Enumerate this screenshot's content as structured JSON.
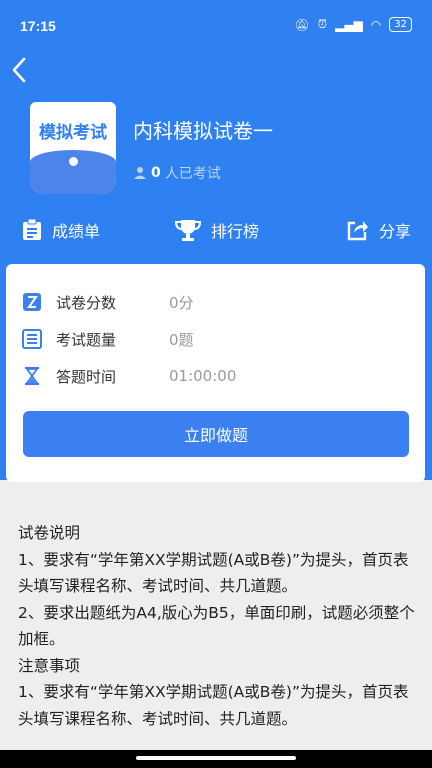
{
  "status_bar": {
    "time": "17:15",
    "battery": "32"
  },
  "header": {
    "cover_label": "模拟考试",
    "title": "内科模拟试卷一",
    "takers_count": "0",
    "takers_suffix": "人已考试"
  },
  "actions": [
    {
      "label": "成绩单",
      "icon": "clipboard-icon"
    },
    {
      "label": "排行榜",
      "icon": "trophy-icon"
    },
    {
      "label": "分享",
      "icon": "share-icon"
    }
  ],
  "info": {
    "rows": [
      {
        "label": "试卷分数",
        "value": "0分",
        "icon": "score-icon"
      },
      {
        "label": "考试题量",
        "value": "0题",
        "icon": "questions-icon"
      },
      {
        "label": "答题时间",
        "value": "01:00:00",
        "icon": "hourglass-icon"
      }
    ],
    "start_label": "立即做题"
  },
  "description": [
    "试卷说明",
    "1、要求有“学年第XX学期试题(A或B卷)”为提头，首页表头填写课程名称、考试时间、共几道题。",
    "2、要求出题纸为A4,版心为B5，单面印刷，试题必须整个加框。",
    "注意事项",
    "1、要求有“学年第XX学期试题(A或B卷)”为提头，首页表头填写课程名称、考试时间、共几道题。"
  ],
  "colors": {
    "primary": "#2f80f0",
    "button": "#3b7ff0",
    "background": "#eeeeee"
  }
}
